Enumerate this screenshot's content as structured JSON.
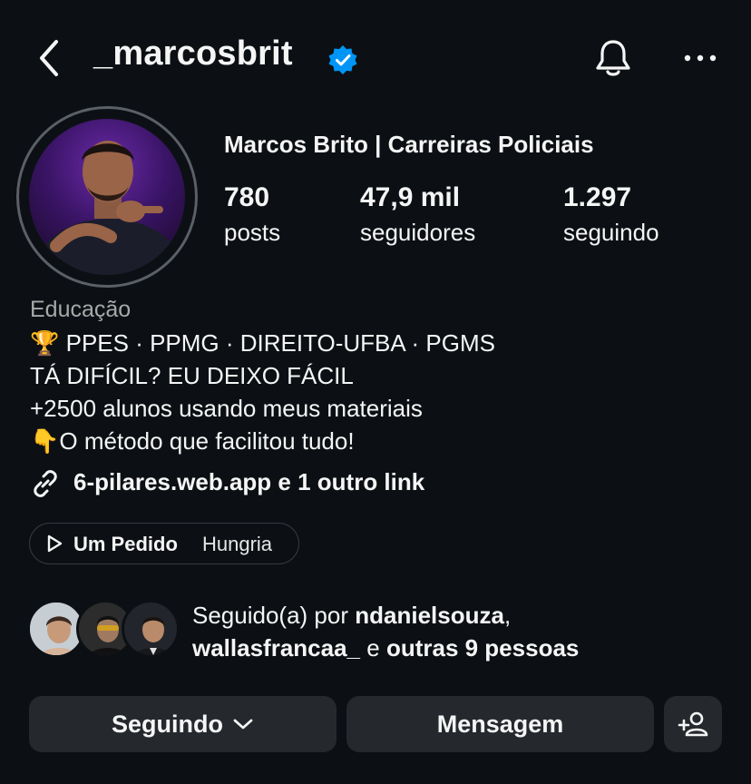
{
  "header": {
    "username": "_marcosbrit",
    "verified_color": "#0095f6"
  },
  "profile": {
    "full_name": "Marcos Brito | Carreiras Policiais",
    "stats": [
      {
        "value": "780",
        "label": "posts"
      },
      {
        "value": "47,9 mil",
        "label": "seguidores"
      },
      {
        "value": "1.297",
        "label": "seguindo"
      }
    ],
    "category": "Educação",
    "bio_lines": [
      "🏆 PPES · PPMG · DIREITO-UFBA · PGMS",
      "TÁ DIFÍCIL? EU DEIXO FÁCIL",
      "+2500 alunos usando meus materiais",
      "👇O método que facilitou tudo!"
    ],
    "link_text": "6-pilares.web.app e 1 outro link"
  },
  "music": {
    "title": "Um Pedido",
    "artist": "Hungria"
  },
  "followed_by": {
    "prefix": "Seguido(a) por ",
    "user1": "ndanielsouza",
    "sep": ",",
    "user2": "wallasfrancaa_",
    "and": " e ",
    "others": "outras 9 pessoas"
  },
  "actions": {
    "following_label": "Seguindo",
    "message_label": "Mensagem"
  },
  "icons": [
    "back-icon",
    "verified-badge-icon",
    "bell-icon",
    "more-icon",
    "link-icon",
    "play-icon",
    "chevron-down-icon",
    "add-person-icon"
  ]
}
